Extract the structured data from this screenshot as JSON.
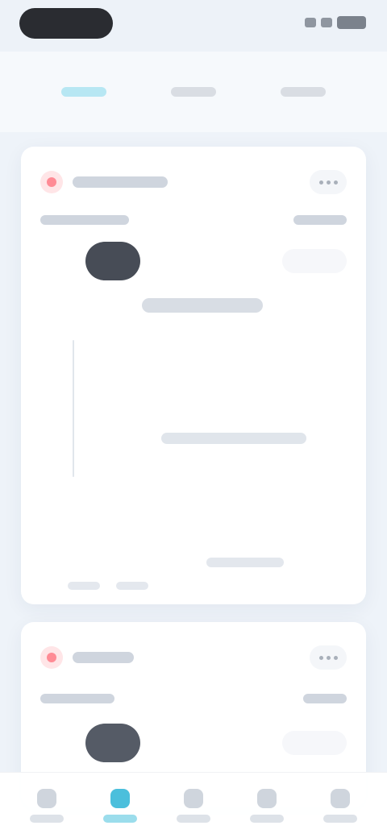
{
  "status_bar": {
    "colors": {
      "pill": "#2a2c31",
      "icons": "#7b828c"
    }
  },
  "tabs": [
    {
      "label": "",
      "active": true
    },
    {
      "label": "",
      "active": false
    },
    {
      "label": "",
      "active": false
    }
  ],
  "cards": [
    {
      "brand_icon": "brand-icon",
      "title": "",
      "menu_icon": "more-icon",
      "meta_left": "",
      "meta_right": "",
      "avatar_name": "",
      "pill_label": "",
      "headline": "",
      "chart_caption": "",
      "legend": [
        "",
        ""
      ]
    },
    {
      "brand_icon": "brand-icon",
      "title": "",
      "menu_icon": "more-icon",
      "meta_left": "",
      "meta_right": "",
      "avatar_name": "",
      "pill_label": ""
    }
  ],
  "bottom_nav": [
    {
      "label": "",
      "icon": "home-icon",
      "active": false
    },
    {
      "label": "",
      "icon": "discover-icon",
      "active": true
    },
    {
      "label": "",
      "icon": "message-icon",
      "active": false
    },
    {
      "label": "",
      "icon": "cart-icon",
      "active": false
    },
    {
      "label": "",
      "icon": "profile-icon",
      "active": false
    }
  ],
  "colors": {
    "accent": "#2aa3c7",
    "brand": "#ff6c7a",
    "background": "#eef3f9"
  }
}
